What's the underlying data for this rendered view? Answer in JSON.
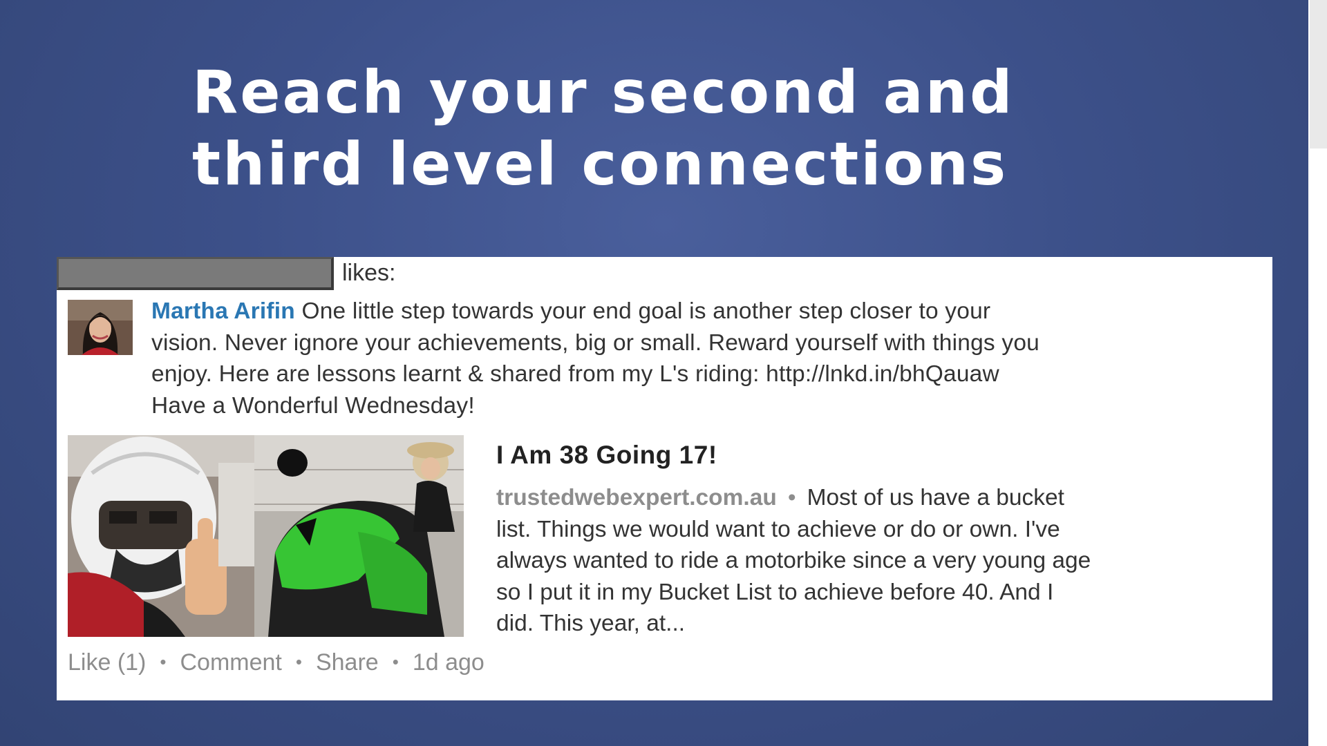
{
  "slide": {
    "title_line1": "Reach your second and",
    "title_line2": "third level connections"
  },
  "post": {
    "likes_label": "likes:",
    "author": "Martha Arifin",
    "text_line1": " One little step towards your end goal is another step closer to your",
    "text_line2": "vision. Never ignore your achievements, big or small. Reward yourself with things you",
    "text_line3": "enjoy. Here are lessons learnt & shared from my L's riding: http://lnkd.in/bhQauaw",
    "text_line4": "Have a Wonderful Wednesday!",
    "link_title": "I Am 38 Going 17!",
    "link_source": "trustedwebexpert.com.au",
    "link_separator": "•",
    "link_desc_line1": "Most of us have a bucket",
    "link_desc_line2": "list. Things we would want to achieve or do or own. I've",
    "link_desc_line3": "always wanted to ride a motorbike since a very young age",
    "link_desc_line4": "so I put it in my Bucket List to achieve before 40. And I",
    "link_desc_line5": "did. This year, at...",
    "like_label": "Like (1)",
    "comment_label": "Comment",
    "share_label": "Share",
    "time_ago": "1d ago",
    "action_separator": "•"
  },
  "colors": {
    "background": "#3c5089",
    "author_link": "#2a77b3",
    "muted_text": "#8d8d8d"
  }
}
